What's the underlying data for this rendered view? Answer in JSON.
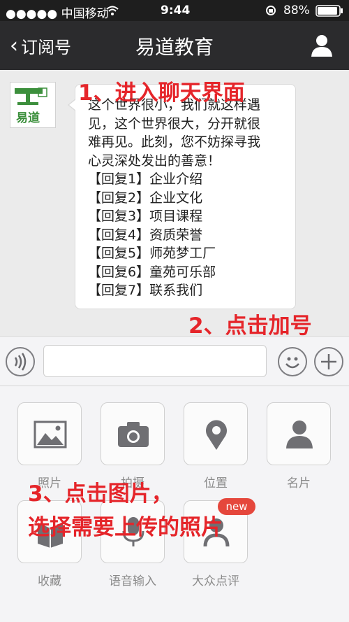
{
  "status_bar": {
    "carrier": "●●●●● 中国移动",
    "time": "9:44",
    "battery": "88%"
  },
  "nav": {
    "back_label": "订阅号",
    "title": "易道教育"
  },
  "avatar": {
    "logo_text": "易道"
  },
  "message": {
    "lines": [
      "这个世界很小，我们就这样遇",
      "见，这个世界很大，分开就很",
      "难再见。此刻，您不妨探寻我",
      "心灵深处发出的善意！",
      "【回复1】企业介绍",
      "【回复2】企业文化",
      "【回复3】项目课程",
      "【回复4】资质荣誉",
      "【回复5】师苑梦工厂",
      "【回复6】童苑可乐部",
      "【回复7】联系我们"
    ]
  },
  "annotations": {
    "step1": "1、进入聊天界面",
    "step2": "2、点击加号",
    "step3_line1": "3、点击图片，",
    "step3_line2": "选择需要上传的照片"
  },
  "input": {
    "placeholder": ""
  },
  "tiles": [
    {
      "label": "照片",
      "icon": "photo-icon"
    },
    {
      "label": "拍摄",
      "icon": "camera-icon"
    },
    {
      "label": "位置",
      "icon": "location-icon"
    },
    {
      "label": "名片",
      "icon": "contact-card-icon"
    },
    {
      "label": "收藏",
      "icon": "favorites-icon"
    },
    {
      "label": "语音输入",
      "icon": "microphone-icon"
    },
    {
      "label": "大众点评",
      "icon": "dianping-icon",
      "badge": "new"
    }
  ],
  "colors": {
    "annotation": "#e5252a",
    "navbar": "#2b2b2d",
    "badge": "#e5473c"
  }
}
